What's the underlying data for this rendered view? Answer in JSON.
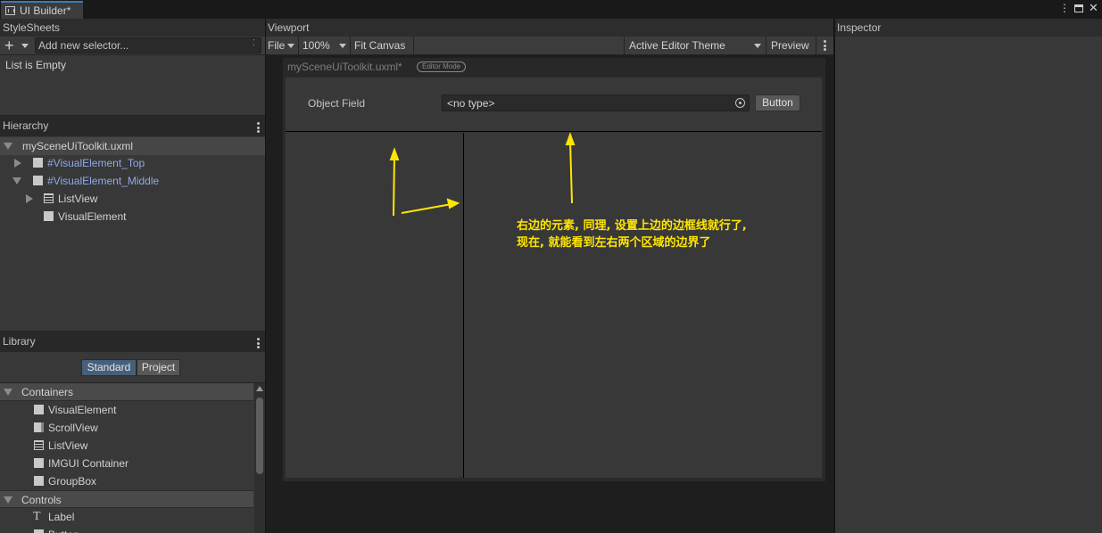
{
  "window": {
    "tab_title": "UI Builder*"
  },
  "stylesheets": {
    "title": "StyleSheets",
    "selector_placeholder": "Add new selector...",
    "empty_text": "List is Empty"
  },
  "hierarchy": {
    "title": "Hierarchy",
    "root": "mySceneUiToolkit.uxml",
    "items": [
      {
        "label": "#VisualElement_Top"
      },
      {
        "label": "#VisualElement_Middle"
      },
      {
        "label": "ListView"
      },
      {
        "label": "VisualElement"
      }
    ]
  },
  "library": {
    "title": "Library",
    "tabs": [
      "Standard",
      "Project"
    ],
    "sections": [
      {
        "title": "Containers",
        "items": [
          "VisualElement",
          "ScrollView",
          "ListView",
          "IMGUI Container",
          "GroupBox"
        ]
      },
      {
        "title": "Controls",
        "items": [
          "Label",
          "Button"
        ]
      }
    ]
  },
  "viewport": {
    "title": "Viewport",
    "toolbar": {
      "file": "File",
      "zoom": "100%",
      "fit": "Fit Canvas",
      "theme": "Active Editor Theme",
      "preview": "Preview"
    },
    "doc_title": "mySceneUiToolkit.uxml*",
    "mode_badge": "Editor Mode",
    "object_field_label": "Object Field",
    "object_field_value": "<no type>",
    "button_label": "Button",
    "annotation_line1": "右边的元素, 同理, 设置上边的边框线就行了,",
    "annotation_line2": "现在, 就能看到左右两个区域的边界了"
  },
  "inspector": {
    "title": "Inspector"
  },
  "colors": {
    "accent": "#3a79bb",
    "annotation": "#ffe600",
    "selector_blue": "#8fa9e8"
  }
}
